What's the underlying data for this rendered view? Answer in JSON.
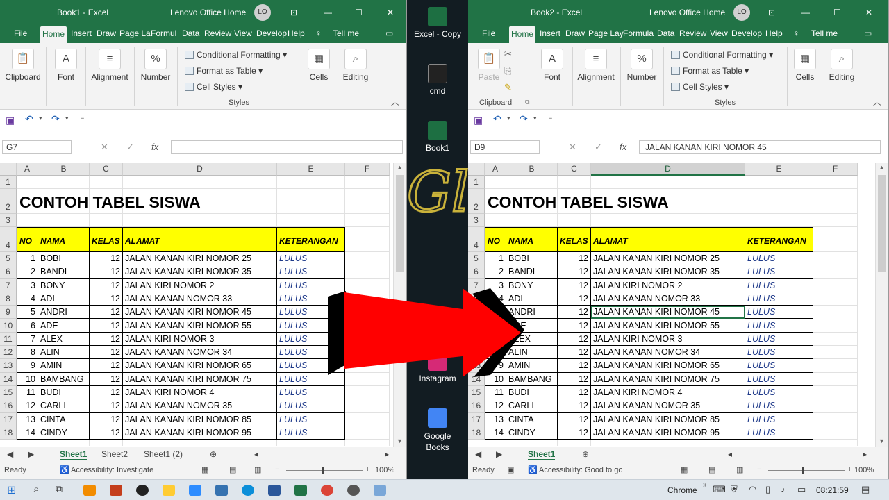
{
  "left": {
    "window_title": "Book1  -  Excel",
    "account": "Lenovo Office Home",
    "avatar": "LO",
    "tabs": [
      "File",
      "Home",
      "Insert",
      "Draw",
      "Page La",
      "Formul",
      "Data",
      "Review",
      "View",
      "Develop",
      "Help"
    ],
    "tell_me": "Tell me",
    "groups": {
      "clipboard": "Clipboard",
      "font": "Font",
      "alignment": "Alignment",
      "number": "Number",
      "cells": "Cells",
      "editing": "Editing",
      "styles": "Styles"
    },
    "styles": {
      "conditional": "Conditional Formatting",
      "format_table": "Format as Table",
      "cell_styles": "Cell Styles"
    },
    "name_box": "G7",
    "formula": "",
    "sheet_tabs": [
      "Sheet1",
      "Sheet2",
      "Sheet1 (2)"
    ],
    "status": {
      "ready": "Ready",
      "accessibility": "Accessibility: Investigate",
      "zoom": "100%"
    }
  },
  "right": {
    "window_title": "Book2  -  Excel",
    "account": "Lenovo Office Home",
    "avatar": "LO",
    "tabs": [
      "File",
      "Home",
      "Insert",
      "Draw",
      "Page Lay",
      "Formula",
      "Data",
      "Review",
      "View",
      "Develop",
      "Help"
    ],
    "tell_me": "Tell me",
    "groups": {
      "clipboard": "Clipboard",
      "font": "Font",
      "alignment": "Alignment",
      "number": "Number",
      "cells": "Cells",
      "editing": "Editing",
      "styles": "Styles",
      "paste": "Paste"
    },
    "styles": {
      "conditional": "Conditional Formatting",
      "format_table": "Format as Table",
      "cell_styles": "Cell Styles"
    },
    "name_box": "D9",
    "formula": "JALAN KANAN KIRI NOMOR 45",
    "sheet_tabs": [
      "Sheet1"
    ],
    "status": {
      "ready": "Ready",
      "accessibility": "Accessibility: Good to go",
      "zoom": "100%"
    }
  },
  "sheet": {
    "columns": [
      "A",
      "B",
      "C",
      "D",
      "E",
      "F"
    ],
    "rows": [
      "1",
      "2",
      "3",
      "4",
      "5",
      "6",
      "7",
      "8",
      "9",
      "10",
      "11",
      "12",
      "13",
      "14",
      "15",
      "16",
      "17",
      "18"
    ],
    "title": "CONTOH TABEL SISWA",
    "headers": [
      "NO",
      "NAMA",
      "KELAS",
      "ALAMAT",
      "KETERANGAN"
    ],
    "records": [
      [
        "1",
        "BOBI",
        "12",
        "JALAN KANAN KIRI NOMOR 25",
        "LULUS"
      ],
      [
        "2",
        "BANDI",
        "12",
        "JALAN KANAN KIRI NOMOR 35",
        "LULUS"
      ],
      [
        "3",
        "BONY",
        "12",
        "JALAN KIRI NOMOR 2",
        "LULUS"
      ],
      [
        "4",
        "ADI",
        "12",
        "JALAN KANAN NOMOR 33",
        "LULUS"
      ],
      [
        "5",
        "ANDRI",
        "12",
        "JALAN KANAN KIRI NOMOR 45",
        "LULUS"
      ],
      [
        "6",
        "ADE",
        "12",
        "JALAN KANAN KIRI NOMOR 55",
        "LULUS"
      ],
      [
        "7",
        "ALEX",
        "12",
        "JALAN KIRI NOMOR 3",
        "LULUS"
      ],
      [
        "8",
        "ALIN",
        "12",
        "JALAN KANAN NOMOR 34",
        "LULUS"
      ],
      [
        "9",
        "AMIN",
        "12",
        "JALAN KANAN KIRI NOMOR 65",
        "LULUS"
      ],
      [
        "10",
        "BAMBANG",
        "12",
        "JALAN KANAN KIRI NOMOR 75",
        "LULUS"
      ],
      [
        "11",
        "BUDI",
        "12",
        "JALAN KIRI NOMOR 4",
        "LULUS"
      ],
      [
        "12",
        "CARLI",
        "12",
        "JALAN KANAN NOMOR 35",
        "LULUS"
      ],
      [
        "13",
        "CINTA",
        "12",
        "JALAN KANAN KIRI NOMOR 85",
        "LULUS"
      ],
      [
        "14",
        "CINDY",
        "12",
        "JALAN KANAN KIRI NOMOR 95",
        "LULUS"
      ]
    ]
  },
  "desktop": {
    "icons": [
      {
        "label": "Excel - Copy",
        "color": "#1d6f42"
      },
      {
        "label": "cmd",
        "color": "#222"
      },
      {
        "label": "Book1",
        "color": "#1d6f42"
      },
      {
        "label": "Instagram",
        "color": "#d62976"
      },
      {
        "label": "Google Books",
        "color": "#4285f4"
      }
    ]
  },
  "taskbar": {
    "chrome_label": "Chrome",
    "time": "08:21:59"
  },
  "colors": {
    "excel_green": "#217346",
    "header_yellow": "#ffff00",
    "arrow_red": "#ff0000"
  }
}
